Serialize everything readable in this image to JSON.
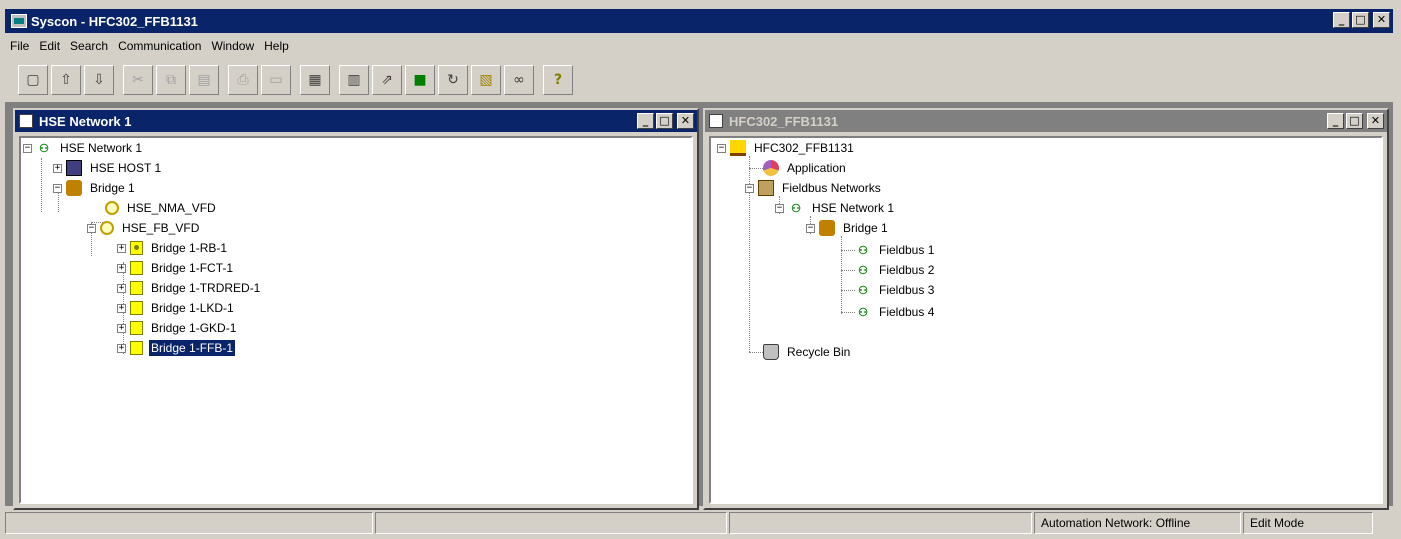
{
  "app": {
    "title": "Syscon - HFC302_FFB1131"
  },
  "menu": [
    "File",
    "Edit",
    "Search",
    "Communication",
    "Window",
    "Help"
  ],
  "toolbar": [
    {
      "name": "new-icon",
      "glyph": "▢"
    },
    {
      "name": "open-icon",
      "glyph": "⇧"
    },
    {
      "name": "save-icon",
      "glyph": "⇩"
    },
    {
      "name": "cut-icon",
      "glyph": "✂"
    },
    {
      "name": "copy-icon",
      "glyph": "⧉"
    },
    {
      "name": "paste-icon",
      "glyph": "▤"
    },
    {
      "name": "print-icon",
      "glyph": "⎙"
    },
    {
      "name": "preview-icon",
      "glyph": "▭"
    },
    {
      "name": "properties-icon",
      "glyph": "▦"
    },
    {
      "name": "attributes-icon",
      "glyph": "▥"
    },
    {
      "name": "export-icon",
      "glyph": "⇗"
    },
    {
      "name": "online-icon",
      "glyph": "■"
    },
    {
      "name": "refresh-icon",
      "glyph": "↻"
    },
    {
      "name": "script-icon",
      "glyph": "▧"
    },
    {
      "name": "watch-icon",
      "glyph": "∞"
    },
    {
      "name": "help-icon",
      "glyph": "?"
    }
  ],
  "left_window": {
    "title": "HSE Network 1",
    "tree": [
      {
        "label": "HSE Network 1",
        "icon": "net"
      },
      {
        "label": "HSE HOST 1",
        "icon": "host"
      },
      {
        "label": "Bridge 1",
        "icon": "bridge"
      },
      {
        "label": "HSE_NMA_VFD",
        "icon": "vfd"
      },
      {
        "label": "HSE_FB_VFD",
        "icon": "vfd"
      },
      {
        "label": "Bridge 1-RB-1",
        "icon": "rb"
      },
      {
        "label": "Bridge 1-FCT-1",
        "icon": "fb"
      },
      {
        "label": "Bridge 1-TRDRED-1",
        "icon": "fb"
      },
      {
        "label": "Bridge 1-LKD-1",
        "icon": "fb"
      },
      {
        "label": "Bridge 1-GKD-1",
        "icon": "fb"
      },
      {
        "label": "Bridge 1-FFB-1",
        "icon": "fb"
      }
    ]
  },
  "right_window": {
    "title": "HFC302_FFB1131",
    "tree": [
      {
        "label": "HFC302_FFB1131",
        "icon": "plant"
      },
      {
        "label": "Application",
        "icon": "app"
      },
      {
        "label": "Fieldbus Networks",
        "icon": "fbnet"
      },
      {
        "label": "HSE Network 1",
        "icon": "net"
      },
      {
        "label": "Bridge 1",
        "icon": "bridge"
      },
      {
        "label": "Fieldbus 1",
        "icon": "net"
      },
      {
        "label": "Fieldbus 2",
        "icon": "net"
      },
      {
        "label": "Fieldbus 3",
        "icon": "net"
      },
      {
        "label": "Fieldbus 4",
        "icon": "net"
      },
      {
        "label": "Recycle Bin",
        "icon": "bin"
      }
    ]
  },
  "status": {
    "network": "Automation Network: Offline",
    "mode": "Edit Mode"
  },
  "window_buttons": {
    "minimize": "_",
    "maximize": "□",
    "close": "✕"
  },
  "colors": {
    "titlebar_active": "#0a246a",
    "titlebar_inactive": "#808080",
    "face": "#d4d0c8"
  }
}
